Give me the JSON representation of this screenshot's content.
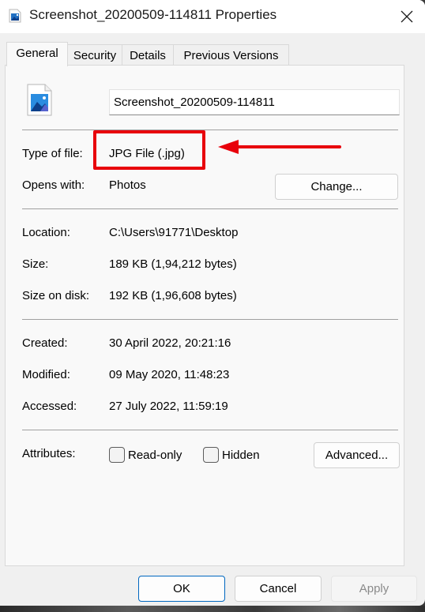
{
  "window": {
    "title": "Screenshot_20200509-114811 Properties",
    "title_icon": "image-file-icon",
    "close_icon": "close-icon"
  },
  "tabs": [
    {
      "label": "General",
      "active": true
    },
    {
      "label": "Security",
      "active": false
    },
    {
      "label": "Details",
      "active": false
    },
    {
      "label": "Previous Versions",
      "active": false
    }
  ],
  "general": {
    "file_icon": "image-file-icon",
    "file_name": "Screenshot_20200509-114811",
    "type_of_file": {
      "label": "Type of file:",
      "value": "JPG File (.jpg)"
    },
    "opens_with": {
      "label": "Opens with:",
      "value": "Photos",
      "change_button": "Change..."
    },
    "location": {
      "label": "Location:",
      "value": "C:\\Users\\91771\\Desktop"
    },
    "size": {
      "label": "Size:",
      "value": "189 KB (1,94,212 bytes)"
    },
    "size_on_disk": {
      "label": "Size on disk:",
      "value": "192 KB (1,96,608 bytes)"
    },
    "created": {
      "label": "Created:",
      "value": "30 April 2022, 20:21:16"
    },
    "modified": {
      "label": "Modified:",
      "value": "09 May 2020, 11:48:23"
    },
    "accessed": {
      "label": "Accessed:",
      "value": "27 July 2022, 11:59:19"
    },
    "attributes": {
      "label": "Attributes:",
      "read_only": {
        "label": "Read-only",
        "checked": false
      },
      "hidden": {
        "label": "Hidden",
        "checked": false
      },
      "advanced_button": "Advanced..."
    }
  },
  "footer": {
    "ok": "OK",
    "cancel": "Cancel",
    "apply": "Apply",
    "apply_enabled": false
  },
  "annotation": {
    "color": "#e8000b",
    "target": "type-of-file-value",
    "shape": "box-with-arrow"
  },
  "colors": {
    "accent": "#0067c0",
    "annotation_red": "#e8000b"
  }
}
